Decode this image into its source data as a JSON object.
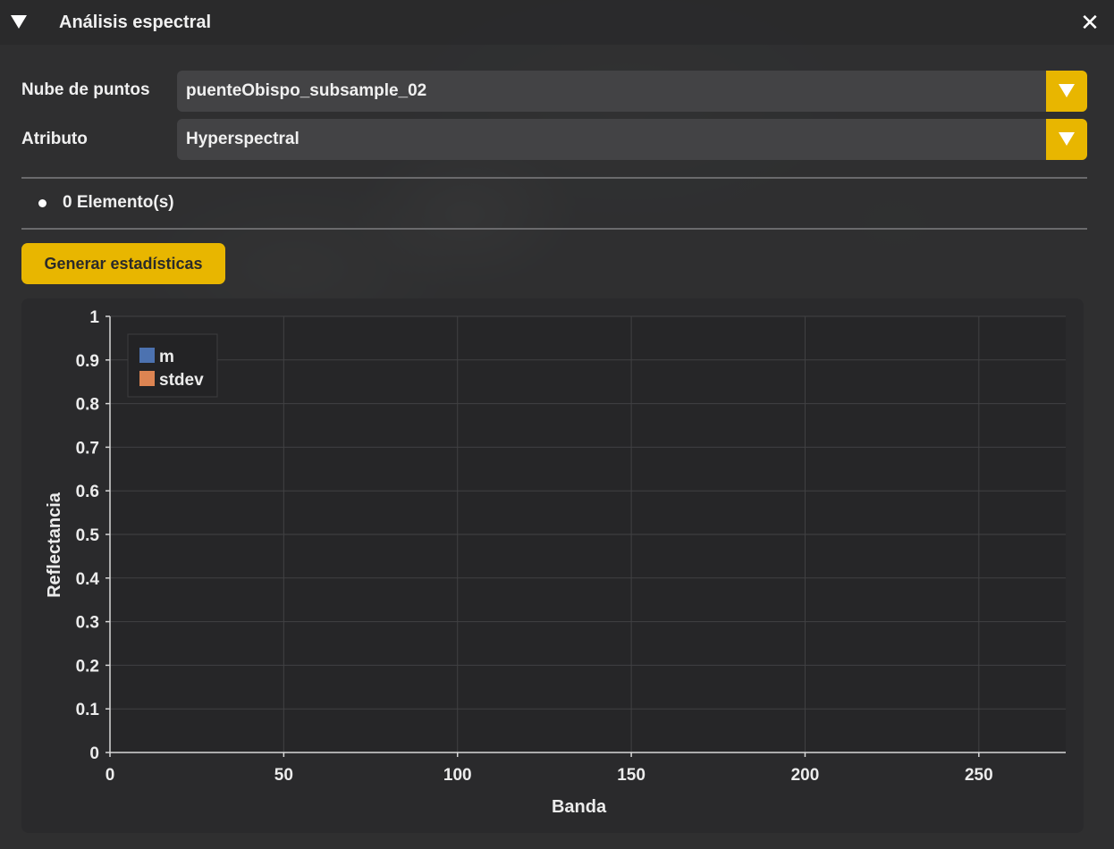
{
  "window": {
    "title": "Análisis espectral",
    "close_symbol": "✕"
  },
  "form": {
    "point_cloud_label": "Nube de puntos",
    "point_cloud_value": "puenteObispo_subsample_02",
    "attribute_label": "Atributo",
    "attribute_value": "Hyperspectral"
  },
  "elements": {
    "text": "0 Elemento(s)"
  },
  "actions": {
    "generate_label": "Generar estadísticas"
  },
  "colors": {
    "accent": "#e8b600",
    "series_m": "#4c72b0",
    "series_stdev": "#dd8452"
  },
  "chart_data": {
    "type": "line",
    "xlabel": "Banda",
    "ylabel": "Reflectancia",
    "xlim": [
      0,
      275
    ],
    "ylim": [
      0,
      1
    ],
    "x_ticks": [
      0,
      50,
      100,
      150,
      200,
      250
    ],
    "y_ticks": [
      0,
      0.1,
      0.2,
      0.3,
      0.4,
      0.5,
      0.6,
      0.7,
      0.8,
      0.9,
      1
    ],
    "grid": true,
    "legend_position": "top-left",
    "series": [
      {
        "name": "m",
        "color": "#4c72b0",
        "x": [],
        "y": []
      },
      {
        "name": "stdev",
        "color": "#dd8452",
        "x": [],
        "y": []
      }
    ]
  }
}
